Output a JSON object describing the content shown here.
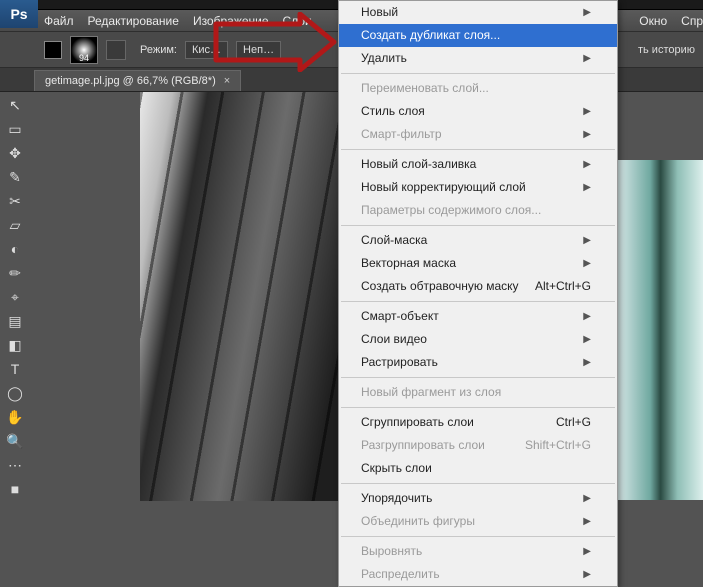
{
  "app": {
    "logo": "Ps"
  },
  "menubar": {
    "items": [
      "Файл",
      "Редактирование",
      "Изображение",
      "Слои"
    ],
    "right": [
      "Окно",
      "Спр"
    ]
  },
  "options": {
    "brush_size": "94",
    "mode_label": "Режим:",
    "mode_value": "Кис…",
    "opacity_value": "Неп…",
    "history_hint": "ть историю"
  },
  "tab": {
    "title": "getimage.pl.jpg @ 66,7% (RGB/8*)",
    "close": "×"
  },
  "tools": [
    "↖",
    "▭",
    "✥",
    "✎",
    "✂",
    "▱",
    "◐",
    "✏",
    "⌖",
    "▤",
    "◧",
    "T",
    "◯",
    "✋",
    "🔍",
    "⋯",
    "■"
  ],
  "menu": {
    "items": [
      {
        "label": "Новый",
        "sub": true
      },
      {
        "label": "Создать дубликат слоя...",
        "sel": true
      },
      {
        "label": "Удалить",
        "sub": true
      },
      {
        "sep": true
      },
      {
        "label": "Переименовать слой...",
        "dis": true
      },
      {
        "label": "Стиль слоя",
        "sub": true
      },
      {
        "label": "Смарт-фильтр",
        "sub": true,
        "dis": true
      },
      {
        "sep": true
      },
      {
        "label": "Новый слой-заливка",
        "sub": true
      },
      {
        "label": "Новый корректирующий слой",
        "sub": true
      },
      {
        "label": "Параметры содержимого слоя...",
        "dis": true
      },
      {
        "sep": true
      },
      {
        "label": "Слой-маска",
        "sub": true
      },
      {
        "label": "Векторная маска",
        "sub": true
      },
      {
        "label": "Создать обтравочную маску",
        "short": "Alt+Ctrl+G"
      },
      {
        "sep": true
      },
      {
        "label": "Смарт-объект",
        "sub": true
      },
      {
        "label": "Слои видео",
        "sub": true
      },
      {
        "label": "Растрировать",
        "sub": true
      },
      {
        "sep": true
      },
      {
        "label": "Новый фрагмент из слоя",
        "dis": true
      },
      {
        "sep": true
      },
      {
        "label": "Сгруппировать слои",
        "short": "Ctrl+G"
      },
      {
        "label": "Разгруппировать слои",
        "short": "Shift+Ctrl+G",
        "dis": true
      },
      {
        "label": "Скрыть слои"
      },
      {
        "sep": true
      },
      {
        "label": "Упорядочить",
        "sub": true
      },
      {
        "label": "Объединить фигуры",
        "sub": true,
        "dis": true
      },
      {
        "sep": true
      },
      {
        "label": "Выровнять",
        "sub": true,
        "dis": true
      },
      {
        "label": "Распределить",
        "sub": true,
        "dis": true
      }
    ]
  }
}
